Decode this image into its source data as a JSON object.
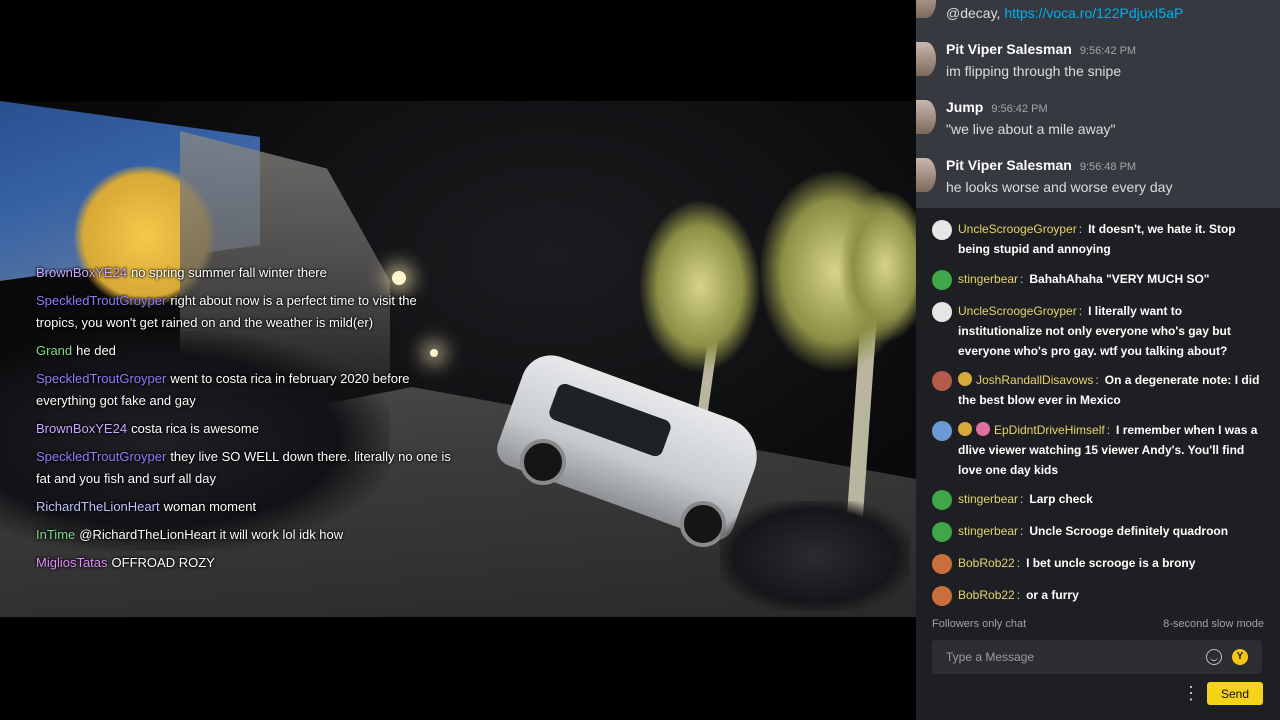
{
  "overlay_chat": [
    {
      "user": "BrownBoxYE24",
      "color": "#c9a7ff",
      "text": "no spring summer fall winter there"
    },
    {
      "user": "SpeckledTroutGroyper",
      "color": "#8f7cff",
      "text": "right about now is a perfect time to visit the tropics, you won't get rained on and the weather is mild(er)"
    },
    {
      "user": "Grand",
      "color": "#7fdc8a",
      "text": "he ded"
    },
    {
      "user": "SpeckledTroutGroyper",
      "color": "#8f7cff",
      "text": "went to costa rica in february 2020 before everything got fake and gay"
    },
    {
      "user": "BrownBoxYE24",
      "color": "#c9a7ff",
      "text": "costa rica is awesome"
    },
    {
      "user": "SpeckledTroutGroyper",
      "color": "#8f7cff",
      "text": "they live SO WELL down there. literally no one is fat and you fish and surf all day"
    },
    {
      "user": "RichardTheLionHeart",
      "color": "#b9c4ff",
      "text": "woman moment"
    },
    {
      "user": "InTime",
      "color": "#7fdc8a",
      "text": "@RichardTheLionHeart it will work lol idk how"
    },
    {
      "user": "MigliosTatas",
      "color": "#e08cff",
      "text": "OFFROAD ROZY"
    }
  ],
  "top_chat": {
    "partial_line": {
      "text": "@decay, ",
      "link": "https://voca.ro/122PdjuxI5aP"
    },
    "messages": [
      {
        "user": "Pit Viper Salesman",
        "time": "9:56:42 PM",
        "text": "im flipping through the snipe"
      },
      {
        "user": "Jump",
        "time": "9:56:42 PM",
        "text": "\"we live about a mile away\""
      },
      {
        "user": "Pit Viper Salesman",
        "time": "9:56:48 PM",
        "text": "he looks worse and worse every day"
      }
    ]
  },
  "live_chat": {
    "messages": [
      {
        "user": "UncleScroogeGroyper",
        "color": "#e8d36a",
        "avatar_color": "#e6e6e6",
        "text": "It doesn't, we hate it. Stop being stupid and annoying"
      },
      {
        "user": "stingerbear",
        "color": "#e8d36a",
        "avatar_color": "#3fa64a",
        "text": "BahahAhaha \"VERY MUCH SO\""
      },
      {
        "user": "UncleScroogeGroyper",
        "color": "#e8d36a",
        "avatar_color": "#e6e6e6",
        "text": "I literally want to institutionalize not only everyone who's gay but everyone who's pro gay. wtf you talking about?"
      },
      {
        "user": "JoshRandallDisavows",
        "color": "#e8d36a",
        "avatar_color": "#b35a4a",
        "text": "On a degenerate note: I did the best blow ever in Mexico"
      },
      {
        "user": "EpDidntDriveHimself",
        "color": "#e8d36a",
        "avatar_color": "#6b9ad6",
        "text": "I remember when I was a dlive viewer watching 15 viewer Andy's. You'll find love one day kids"
      },
      {
        "user": "stingerbear",
        "color": "#e8d36a",
        "avatar_color": "#3fa64a",
        "text": "Larp check"
      },
      {
        "user": "stingerbear",
        "color": "#e8d36a",
        "avatar_color": "#3fa64a",
        "text": "Uncle Scrooge definitely quadroon"
      },
      {
        "user": "BobRob22",
        "color": "#e8d36a",
        "avatar_color": "#c8703d",
        "text": "I bet uncle scrooge is a brony"
      },
      {
        "user": "BobRob22",
        "color": "#e8d36a",
        "avatar_color": "#c8703d",
        "text": "or a furry"
      }
    ],
    "followers_only": "Followers only chat",
    "slow_mode": "8-second slow mode",
    "input_placeholder": "Type a Message",
    "rant_glyph": "Y",
    "more_glyph": "⋮",
    "send_label": "Send"
  }
}
